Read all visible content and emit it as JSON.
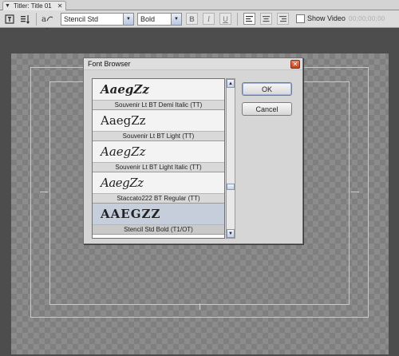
{
  "tab": {
    "title": "Titler: Title 01"
  },
  "toolbar": {
    "font_family": "Stencil Std",
    "font_style": "Bold",
    "bold_label": "B",
    "italic_label": "I",
    "underline_label": "U",
    "show_video_label": "Show Video",
    "show_video_checked": false,
    "timecode": "00;00;00;00"
  },
  "dialog": {
    "title": "Font Browser",
    "ok_label": "OK",
    "cancel_label": "Cancel",
    "fonts": [
      {
        "sample": "AaegZz",
        "name": "Souvenir Lt BT Demi Italic (TT)",
        "selected": false
      },
      {
        "sample": "AaegZz",
        "name": "Souvenir Lt BT Light (TT)",
        "selected": false
      },
      {
        "sample": "AaegZz",
        "name": "Souvenir Lt BT Light Italic (TT)",
        "selected": false
      },
      {
        "sample": "AaegZz",
        "name": "Staccato222 BT Regular (TT)",
        "selected": false
      },
      {
        "sample": "AAEGZZ",
        "name": "Stencil Std Bold (T1/OT)",
        "selected": true
      }
    ]
  },
  "colors": {
    "selected_row": "#c6cddb",
    "close_button": "#c5401f"
  }
}
